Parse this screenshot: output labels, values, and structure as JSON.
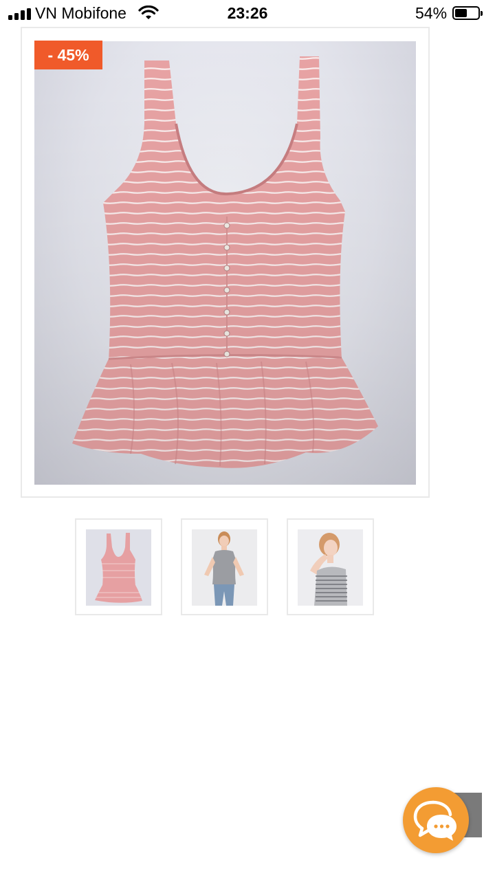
{
  "status_bar": {
    "carrier": "VN Mobifone",
    "time": "23:26",
    "battery_percent": "54%",
    "battery_level": 0.54,
    "icons": [
      "signal-bars-icon",
      "wifi-icon",
      "battery-icon"
    ]
  },
  "product": {
    "discount_badge": "- 45%",
    "main_image": "pink-striped-peplum-tank-top-photo",
    "thumbnails": [
      {
        "name": "thumbnail-flat-lay",
        "selected": true
      },
      {
        "name": "thumbnail-model-gray-tank",
        "selected": false
      },
      {
        "name": "thumbnail-model-striped-tank",
        "selected": false
      }
    ]
  },
  "floating": {
    "chat_icon": "chat-bubbles-icon",
    "scroll_tab": "scroll-to-top-tab"
  },
  "colors": {
    "badge": "#f05a2a",
    "chat_button": "#f39c33",
    "border": "#e9e9e9",
    "garment": "#e9a2a2"
  }
}
